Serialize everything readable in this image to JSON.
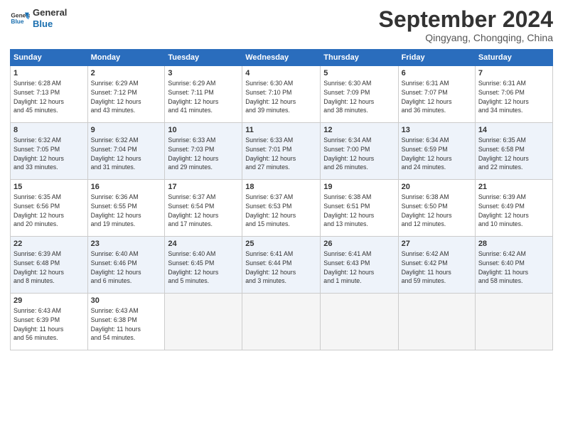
{
  "header": {
    "logo_line1": "General",
    "logo_line2": "Blue",
    "month_title": "September 2024",
    "location": "Qingyang, Chongqing, China"
  },
  "calendar": {
    "days_of_week": [
      "Sunday",
      "Monday",
      "Tuesday",
      "Wednesday",
      "Thursday",
      "Friday",
      "Saturday"
    ],
    "weeks": [
      [
        {
          "day": "",
          "empty": true
        },
        {
          "day": "2",
          "sunrise": "6:29 AM",
          "sunset": "7:12 PM",
          "daylight": "12 hours and 43 minutes."
        },
        {
          "day": "3",
          "sunrise": "6:29 AM",
          "sunset": "7:11 PM",
          "daylight": "12 hours and 41 minutes."
        },
        {
          "day": "4",
          "sunrise": "6:30 AM",
          "sunset": "7:10 PM",
          "daylight": "12 hours and 39 minutes."
        },
        {
          "day": "5",
          "sunrise": "6:30 AM",
          "sunset": "7:09 PM",
          "daylight": "12 hours and 38 minutes."
        },
        {
          "day": "6",
          "sunrise": "6:31 AM",
          "sunset": "7:07 PM",
          "daylight": "12 hours and 36 minutes."
        },
        {
          "day": "7",
          "sunrise": "6:31 AM",
          "sunset": "7:06 PM",
          "daylight": "12 hours and 34 minutes."
        }
      ],
      [
        {
          "day": "1",
          "sunrise": "6:28 AM",
          "sunset": "7:13 PM",
          "daylight": "12 hours and 45 minutes."
        },
        {
          "day": "",
          "empty": true
        },
        {
          "day": "",
          "empty": true
        },
        {
          "day": "",
          "empty": true
        },
        {
          "day": "",
          "empty": true
        },
        {
          "day": "",
          "empty": true
        },
        {
          "day": "",
          "empty": true
        }
      ],
      [
        {
          "day": "8",
          "sunrise": "6:32 AM",
          "sunset": "7:05 PM",
          "daylight": "12 hours and 33 minutes."
        },
        {
          "day": "9",
          "sunrise": "6:32 AM",
          "sunset": "7:04 PM",
          "daylight": "12 hours and 31 minutes."
        },
        {
          "day": "10",
          "sunrise": "6:33 AM",
          "sunset": "7:03 PM",
          "daylight": "12 hours and 29 minutes."
        },
        {
          "day": "11",
          "sunrise": "6:33 AM",
          "sunset": "7:01 PM",
          "daylight": "12 hours and 27 minutes."
        },
        {
          "day": "12",
          "sunrise": "6:34 AM",
          "sunset": "7:00 PM",
          "daylight": "12 hours and 26 minutes."
        },
        {
          "day": "13",
          "sunrise": "6:34 AM",
          "sunset": "6:59 PM",
          "daylight": "12 hours and 24 minutes."
        },
        {
          "day": "14",
          "sunrise": "6:35 AM",
          "sunset": "6:58 PM",
          "daylight": "12 hours and 22 minutes."
        }
      ],
      [
        {
          "day": "15",
          "sunrise": "6:35 AM",
          "sunset": "6:56 PM",
          "daylight": "12 hours and 20 minutes."
        },
        {
          "day": "16",
          "sunrise": "6:36 AM",
          "sunset": "6:55 PM",
          "daylight": "12 hours and 19 minutes."
        },
        {
          "day": "17",
          "sunrise": "6:37 AM",
          "sunset": "6:54 PM",
          "daylight": "12 hours and 17 minutes."
        },
        {
          "day": "18",
          "sunrise": "6:37 AM",
          "sunset": "6:53 PM",
          "daylight": "12 hours and 15 minutes."
        },
        {
          "day": "19",
          "sunrise": "6:38 AM",
          "sunset": "6:51 PM",
          "daylight": "12 hours and 13 minutes."
        },
        {
          "day": "20",
          "sunrise": "6:38 AM",
          "sunset": "6:50 PM",
          "daylight": "12 hours and 12 minutes."
        },
        {
          "day": "21",
          "sunrise": "6:39 AM",
          "sunset": "6:49 PM",
          "daylight": "12 hours and 10 minutes."
        }
      ],
      [
        {
          "day": "22",
          "sunrise": "6:39 AM",
          "sunset": "6:48 PM",
          "daylight": "12 hours and 8 minutes."
        },
        {
          "day": "23",
          "sunrise": "6:40 AM",
          "sunset": "6:46 PM",
          "daylight": "12 hours and 6 minutes."
        },
        {
          "day": "24",
          "sunrise": "6:40 AM",
          "sunset": "6:45 PM",
          "daylight": "12 hours and 5 minutes."
        },
        {
          "day": "25",
          "sunrise": "6:41 AM",
          "sunset": "6:44 PM",
          "daylight": "12 hours and 3 minutes."
        },
        {
          "day": "26",
          "sunrise": "6:41 AM",
          "sunset": "6:43 PM",
          "daylight": "12 hours and 1 minute."
        },
        {
          "day": "27",
          "sunrise": "6:42 AM",
          "sunset": "6:42 PM",
          "daylight": "11 hours and 59 minutes."
        },
        {
          "day": "28",
          "sunrise": "6:42 AM",
          "sunset": "6:40 PM",
          "daylight": "11 hours and 58 minutes."
        }
      ],
      [
        {
          "day": "29",
          "sunrise": "6:43 AM",
          "sunset": "6:39 PM",
          "daylight": "11 hours and 56 minutes."
        },
        {
          "day": "30",
          "sunrise": "6:43 AM",
          "sunset": "6:38 PM",
          "daylight": "11 hours and 54 minutes."
        },
        {
          "day": "",
          "empty": true
        },
        {
          "day": "",
          "empty": true
        },
        {
          "day": "",
          "empty": true
        },
        {
          "day": "",
          "empty": true
        },
        {
          "day": "",
          "empty": true
        }
      ]
    ]
  }
}
